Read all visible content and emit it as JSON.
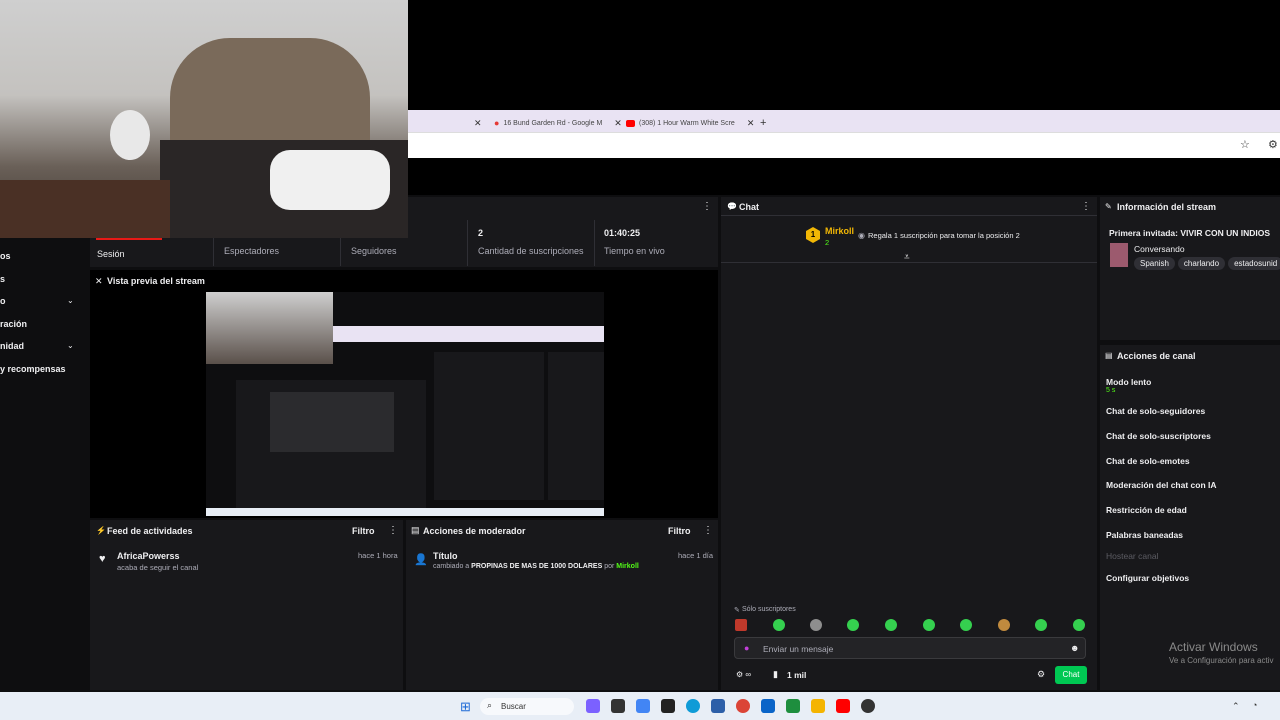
{
  "browser": {
    "tabs": [
      {
        "label": "16 Bund Garden Rd - Google M",
        "icon": "maps-pin-icon"
      },
      {
        "label": "(308) 1 Hour Warm White Scre",
        "icon": "youtube-icon"
      }
    ],
    "new_tab": "+"
  },
  "sidebar": {
    "items": [
      {
        "label": "os"
      },
      {
        "label": "s"
      },
      {
        "label": "o",
        "chevron": true
      },
      {
        "label": "ración"
      },
      {
        "label": "nidad",
        "chevron": true
      },
      {
        "label": "y recompensas"
      }
    ]
  },
  "stats": {
    "sesion_label": "Sesión",
    "espectadores_label": "Espectadores",
    "seguidores_label": "Seguidores",
    "suscripciones_value": "2",
    "suscripciones_label": "Cantidad de suscripciones",
    "tiempo_value": "01:40:25",
    "tiempo_label": "Tiempo en vivo"
  },
  "preview": {
    "title": "Vista previa del stream"
  },
  "activity": {
    "title": "Feed de actividades",
    "filter": "Filtro",
    "item": {
      "user": "AfricaPowerss",
      "text": "acaba de seguir el canal",
      "time": "hace 1 hora"
    }
  },
  "modactions": {
    "title": "Acciones de moderador",
    "filter": "Filtro",
    "item": {
      "heading": "Título",
      "prefix": "cambiado a",
      "value": "PROPINAS DE MAS DE 1000 DOLARES",
      "by": "por",
      "user": "Mirkoll",
      "time": "hace 1 día"
    }
  },
  "chat": {
    "title": "Chat",
    "leader": {
      "name": "Mirkoll",
      "count": "2",
      "rank": "1"
    },
    "gift_text": "Regala 1 suscripción para tomar la posición 2",
    "subs_only": "Sólo suscriptores",
    "placeholder": "Enviar un mensaje",
    "viewers": "1 mil",
    "send": "Chat"
  },
  "streaminfo": {
    "title": "Información del stream",
    "guest": "Primera invitada: VIVIR CON UN INDIOS",
    "category": "Conversando",
    "tags": [
      "Spanish",
      "charlando",
      "estadosunid"
    ]
  },
  "channel_actions": {
    "title": "Acciones de canal",
    "slow_mode": "Modo lento",
    "slow_value": "5 s",
    "items": [
      "Chat de solo-seguidores",
      "Chat de solo-suscriptores",
      "Chat de solo-emotes",
      "Moderación del chat con IA",
      "Restricción de edad",
      "Palabras baneadas"
    ],
    "host": "Hostear canal",
    "goals": "Configurar objetivos"
  },
  "watermark": {
    "line1": "Activar Windows",
    "line2": "Ve a Configuración para activ"
  },
  "taskbar": {
    "search": "Buscar"
  },
  "colors": {
    "accent_green": "#53fc18",
    "bg_dark": "#0e0e10",
    "panel": "#18181b",
    "red": "#e91916"
  }
}
